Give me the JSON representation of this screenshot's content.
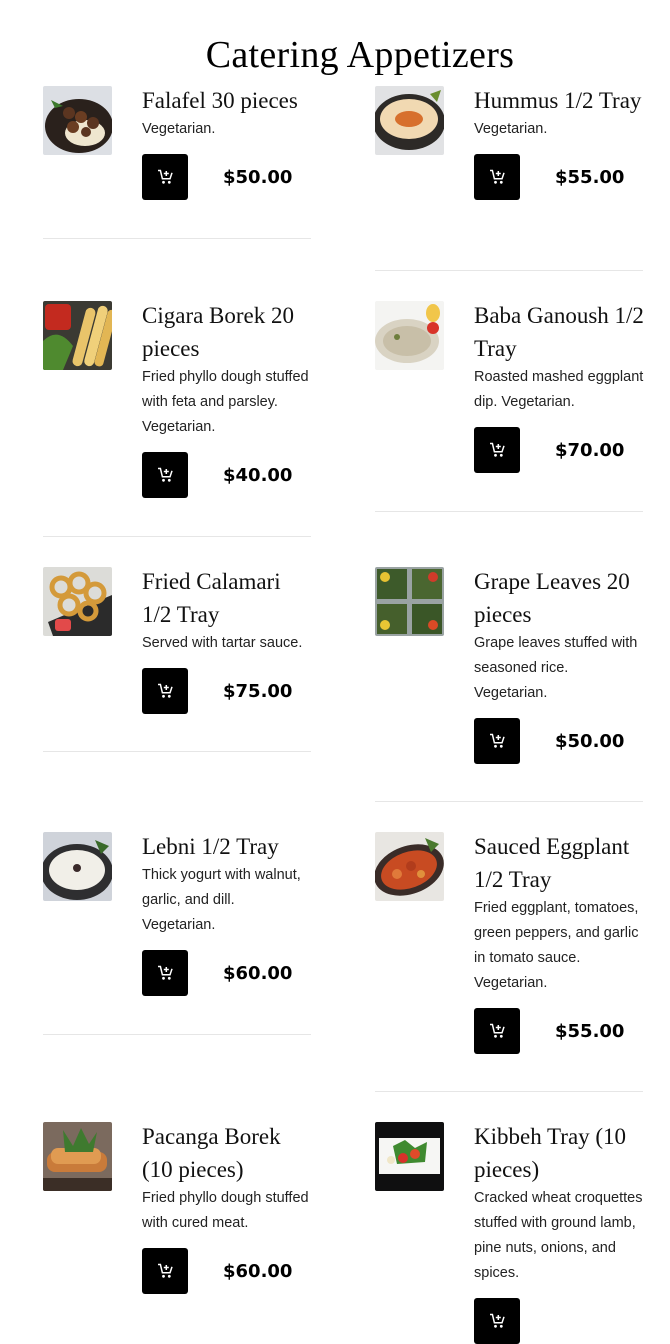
{
  "page": {
    "title": "Catering Appetizers"
  },
  "items": [
    {
      "name": "Falafel 30 pieces",
      "description": "Vegetarian.",
      "price": "$50.00",
      "image": "falafel-plate-image"
    },
    {
      "name": "Hummus 1/2 Tray",
      "description": "Vegetarian.",
      "price": "$55.00",
      "image": "hummus-plate-image"
    },
    {
      "name": "Cigara Borek 20 pieces",
      "description": "Fried phyllo dough stuffed with feta and parsley. Vegetarian.",
      "price": "$40.00",
      "image": "cigara-borek-image"
    },
    {
      "name": "Baba Ganoush 1/2 Tray",
      "description": "Roasted mashed eggplant dip. Vegetarian.",
      "price": "$70.00",
      "image": "baba-ganoush-image"
    },
    {
      "name": "Fried Calamari 1/2 Tray",
      "description": "Served with tartar sauce.",
      "price": "$75.00",
      "image": "fried-calamari-image"
    },
    {
      "name": "Grape Leaves 20 pieces",
      "description": "Grape leaves stuffed with seasoned rice. Vegetarian.",
      "price": "$50.00",
      "image": "grape-leaves-image"
    },
    {
      "name": "Lebni 1/2 Tray",
      "description": "Thick yogurt with walnut, garlic, and dill. Vegetarian.",
      "price": "$60.00",
      "image": "lebni-image"
    },
    {
      "name": "Sauced Eggplant 1/2 Tray",
      "description": "Fried eggplant, tomatoes, green peppers, and garlic in tomato sauce. Vegetarian.",
      "price": "$55.00",
      "image": "sauced-eggplant-image"
    },
    {
      "name": "Pacanga Borek (10 pieces)",
      "description": "Fried phyllo dough stuffed with cured meat.",
      "price": "$60.00",
      "image": "pacanga-borek-image"
    },
    {
      "name": "Kibbeh Tray (10 pieces)",
      "description": "Cracked wheat croquettes stuffed with ground lamb, pine nuts, onions, and spices.",
      "price": "",
      "image": "kibbeh-tray-image"
    }
  ],
  "icons": {
    "cart": "add-to-cart-icon"
  }
}
